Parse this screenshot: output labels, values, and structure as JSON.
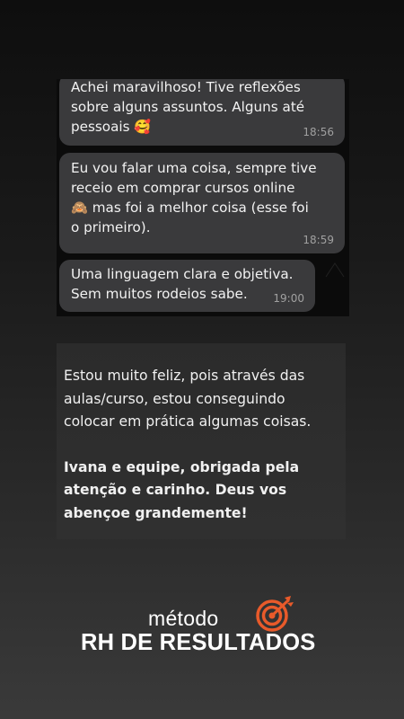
{
  "chat": {
    "messages": [
      {
        "lines": [
          "Achei maravilhoso! Tive reflexões",
          "sobre alguns assuntos. Alguns até",
          "pessoais"
        ],
        "emoji": "🥰",
        "time": "18:56"
      },
      {
        "lines": [
          "Eu vou falar uma coisa, sempre tive",
          "receio em comprar cursos online",
          "mas foi a melhor coisa (esse foi",
          "o primeiro)."
        ],
        "emoji": "🙈",
        "time": "18:59"
      },
      {
        "lines": [
          "Uma linguagem clara e objetiva.",
          "Sem muitos rodeios sabe."
        ],
        "time": "19:00"
      }
    ]
  },
  "testimonial": {
    "lines": [
      "Estou muito feliz, pois através das",
      "aulas/curso, estou conseguindo",
      "colocar em prática algumas coisas."
    ],
    "closing_lines": [
      "Ivana e equipe, obrigada pela",
      "atenção e carinho. Deus vos",
      "abençoe grandemente!"
    ]
  },
  "brand": {
    "sub": "método",
    "main": "RH DE RESULTADOS",
    "icon": "target-arrow-icon",
    "accent": "#e85a2a"
  }
}
